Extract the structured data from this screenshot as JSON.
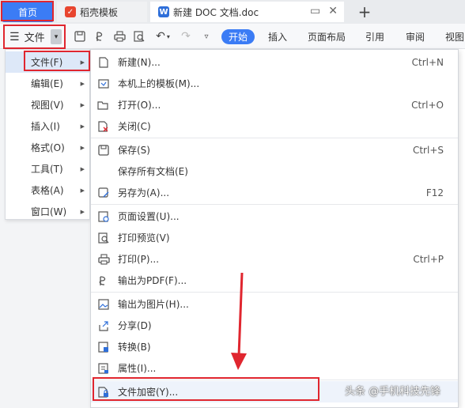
{
  "tabs": {
    "home": "首页",
    "daoke": "稻壳模板",
    "doc": "新建 DOC 文档.doc",
    "plus": "+"
  },
  "toolbar": {
    "menu_label": "文件",
    "ribbon_tabs": [
      "开始",
      "插入",
      "页面布局",
      "引用",
      "审阅",
      "视图"
    ]
  },
  "left_menu": [
    {
      "label": "文件(F)"
    },
    {
      "label": "编辑(E)"
    },
    {
      "label": "视图(V)"
    },
    {
      "label": "插入(I)"
    },
    {
      "label": "格式(O)"
    },
    {
      "label": "工具(T)"
    },
    {
      "label": "表格(A)"
    },
    {
      "label": "窗口(W)"
    }
  ],
  "file_menu": [
    {
      "icon": "new-doc-icon",
      "label": "新建(N)...",
      "shortcut": "Ctrl+N"
    },
    {
      "icon": "template-icon",
      "label": "本机上的模板(M)...",
      "shortcut": ""
    },
    {
      "icon": "folder-open-icon",
      "label": "打开(O)...",
      "shortcut": "Ctrl+O"
    },
    {
      "icon": "close-doc-icon",
      "label": "关闭(C)",
      "shortcut": ""
    },
    {
      "icon": "save-icon",
      "label": "保存(S)",
      "shortcut": "Ctrl+S"
    },
    {
      "icon": "",
      "label": "保存所有文档(E)",
      "shortcut": ""
    },
    {
      "icon": "save-as-icon",
      "label": "另存为(A)...",
      "shortcut": "F12"
    },
    {
      "icon": "page-setup-icon",
      "label": "页面设置(U)...",
      "shortcut": ""
    },
    {
      "icon": "print-preview-icon",
      "label": "打印预览(V)",
      "shortcut": ""
    },
    {
      "icon": "print-icon",
      "label": "打印(P)...",
      "shortcut": "Ctrl+P"
    },
    {
      "icon": "export-pdf-icon",
      "label": "输出为PDF(F)...",
      "shortcut": ""
    },
    {
      "icon": "export-image-icon",
      "label": "输出为图片(H)...",
      "shortcut": ""
    },
    {
      "icon": "share-icon",
      "label": "分享(D)",
      "shortcut": ""
    },
    {
      "icon": "convert-icon",
      "label": "转换(B)",
      "shortcut": ""
    },
    {
      "icon": "properties-icon",
      "label": "属性(I)...",
      "shortcut": ""
    },
    {
      "icon": "encrypt-icon",
      "label": "文件加密(Y)...",
      "shortcut": ""
    }
  ],
  "watermark": "头条 @手机科技先锋",
  "colors": {
    "accent": "#3b7cf5",
    "highlight_box": "#e0262f",
    "arrow": "#e0262f"
  }
}
